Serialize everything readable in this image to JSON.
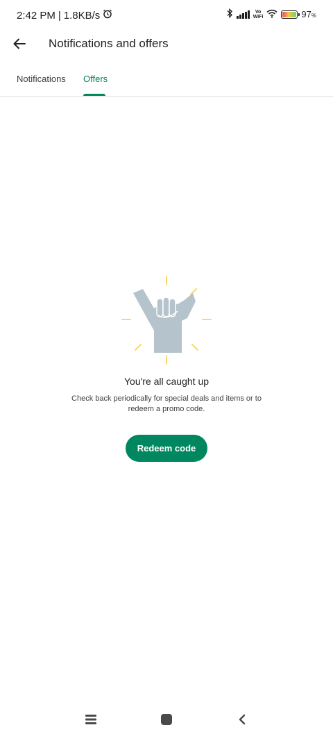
{
  "status_bar": {
    "time": "2:42 PM",
    "separator": "|",
    "network_speed": "1.8KB/s",
    "battery_percent": "97",
    "battery_unit": "%",
    "vowifi_top": "Vo",
    "vowifi_bottom": "WiFi",
    "battery_level": 0.97,
    "icons": [
      "alarm-icon",
      "bluetooth-icon",
      "signal-icon",
      "vowifi-icon",
      "wifi-icon",
      "battery-icon"
    ]
  },
  "app_bar": {
    "title": "Notifications and offers",
    "back_icon": "arrow-back-icon"
  },
  "tabs": [
    {
      "label": "Notifications",
      "selected": false
    },
    {
      "label": "Offers",
      "selected": true
    }
  ],
  "empty_state": {
    "illustration": "shaka-hand-illustration",
    "title": "You're all caught up",
    "description": "Check back periodically for special deals and items or to redeem a promo code.",
    "button_label": "Redeem code"
  },
  "nav_bar": {
    "icons": [
      "menu-icon",
      "home-icon",
      "back-icon"
    ]
  },
  "colors": {
    "accent": "#01875f",
    "text_primary": "#202124",
    "divider": "#dadce0",
    "illustration_hand": "#b4c3cc",
    "illustration_rays": "#fbd86a"
  }
}
